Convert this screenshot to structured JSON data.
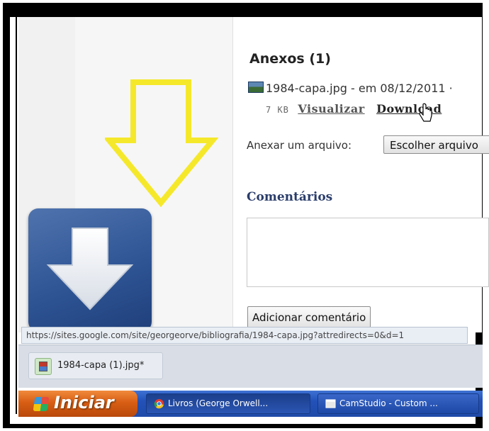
{
  "attachments": {
    "title": "Anexos (1)",
    "file_name_line": "1984-capa.jpg - em 08/12/2011 ·",
    "size": "7 KB",
    "view_link": "Visualizar",
    "download_link": "Download"
  },
  "attach_file": {
    "label": "Anexar um arquivo:",
    "button_label": "Escolher arquivo"
  },
  "comments": {
    "title": "Comentários",
    "add_button_label": "Adicionar comentário"
  },
  "status_url": "https://sites.google.com/site/georgeorve/bibliografia/1984-capa.jpg?attredirects=0&d=1",
  "downloads_bar": {
    "item_label": "1984-capa (1).jpg*"
  },
  "taskbar": {
    "start_label": "Iniciar",
    "tasks": [
      {
        "label": "Livros (George Orwell..."
      },
      {
        "label": "CamStudio - Custom ..."
      }
    ]
  },
  "colors": {
    "annotation_arrow": "#f5e82a",
    "download_tile": "#2f5595",
    "taskbar": "#2251b8",
    "start_button": "#d85e14"
  },
  "icons": {
    "big_overlay": "download-arrow-icon",
    "annotation": "yellow-down-arrow-icon"
  }
}
